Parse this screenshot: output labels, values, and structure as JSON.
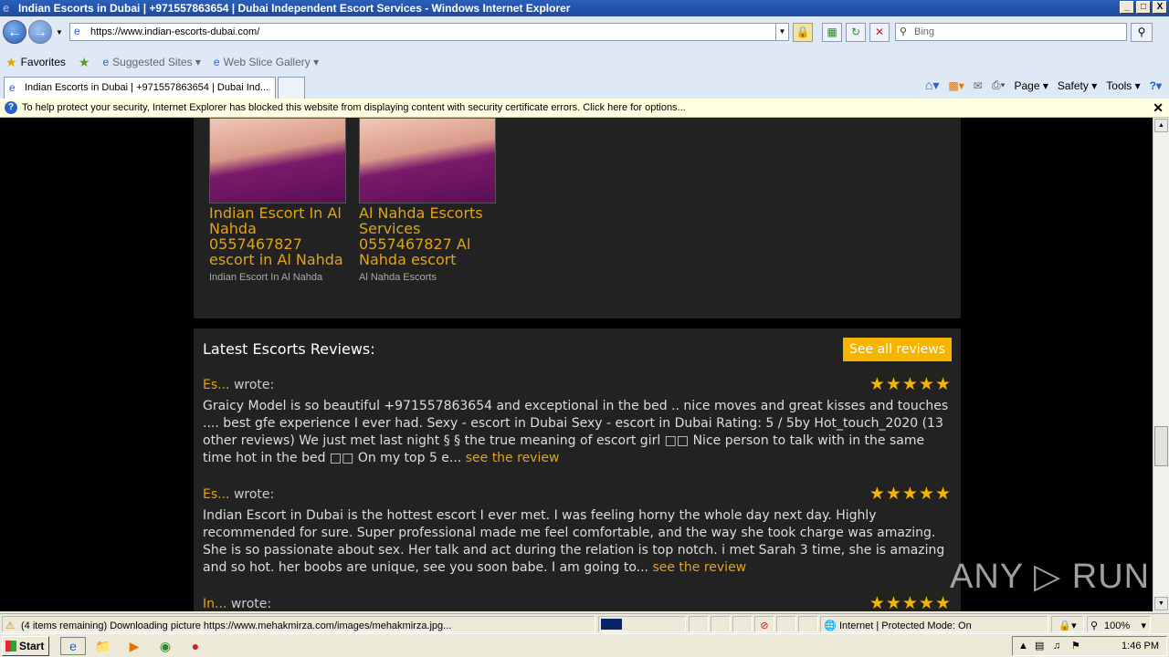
{
  "window": {
    "title": "Indian Escorts in Dubai | +971557863654 | Dubai Independent Escort Services - Windows Internet Explorer",
    "controls": [
      "_",
      "□",
      "X"
    ]
  },
  "nav": {
    "back_icon": "back-arrow-icon",
    "forward_icon": "forward-arrow-icon",
    "address": "https://www.indian-escorts-dubai.com/",
    "search_placeholder": "Bing"
  },
  "favorites": {
    "favorites_label": "Favorites",
    "suggested_label": "Suggested Sites ▾",
    "webslice_label": "Web Slice Gallery ▾"
  },
  "tab": {
    "label": "Indian Escorts in Dubai | +971557863654 | Dubai Ind..."
  },
  "commands": {
    "page": "Page ▾",
    "safety": "Safety ▾",
    "tools": "Tools ▾"
  },
  "infobar": {
    "message": "To help protect your security, Internet Explorer has blocked this website from displaying content with security certificate errors. Click here for options..."
  },
  "cards": [
    {
      "title": "Indian Escort In Al Nahda 0557467827 escort in Al Nahda",
      "sub": "Indian Escort In Al Nahda"
    },
    {
      "title": "Al Nahda Escorts Services 0557467827 Al Nahda escort",
      "sub": "Al Nahda Escorts"
    }
  ],
  "reviews_section": {
    "title": "Latest Escorts Reviews:",
    "see_all": "See all reviews",
    "wrote": "wrote:",
    "reviews": [
      {
        "author": "Es...",
        "stars": "★★★★★",
        "rating": 5,
        "text": "Graicy Model is so beautiful +971557863654 and exceptional in the bed .. nice moves and great kisses and touches .... best gfe experience I ever had. Sexy - escort in Dubai Sexy - escort in Dubai Rating: 5 / 5by Hot_touch_2020 (13 other reviews) We just met last night § § the true meaning of escort girl □□ Nice person to talk with in the same time hot in the bed □□ On my top 5 e... ",
        "link": "see the review"
      },
      {
        "author": "Es...",
        "stars": "★★★★★",
        "rating": 5,
        "text": "Indian Escort in Dubai is the hottest escort I ever met. I was feeling horny the whole day next day. Highly recommended for sure. Super professional made me feel comfortable, and the way she took charge was amazing. She is so passionate about sex. Her talk and act during the relation is top notch. i met Sarah 3 time, she is amazing and so hot. her boobs are unique, see you soon babe. I am going to... ",
        "link": "see the review"
      },
      {
        "author": "In...",
        "stars": "★★★★★",
        "rating": 5,
        "text": "",
        "link": ""
      }
    ]
  },
  "watermark": "ANY ▷ RUN",
  "status": {
    "text": "(4 items remaining) Downloading picture https://www.mehakmirza.com/images/mehakmirza.jpg...",
    "progress": 0.25,
    "zone": "Internet | Protected Mode: On",
    "zoom": "100%"
  },
  "taskbar": {
    "start": "Start",
    "clock": "1:46 PM"
  }
}
